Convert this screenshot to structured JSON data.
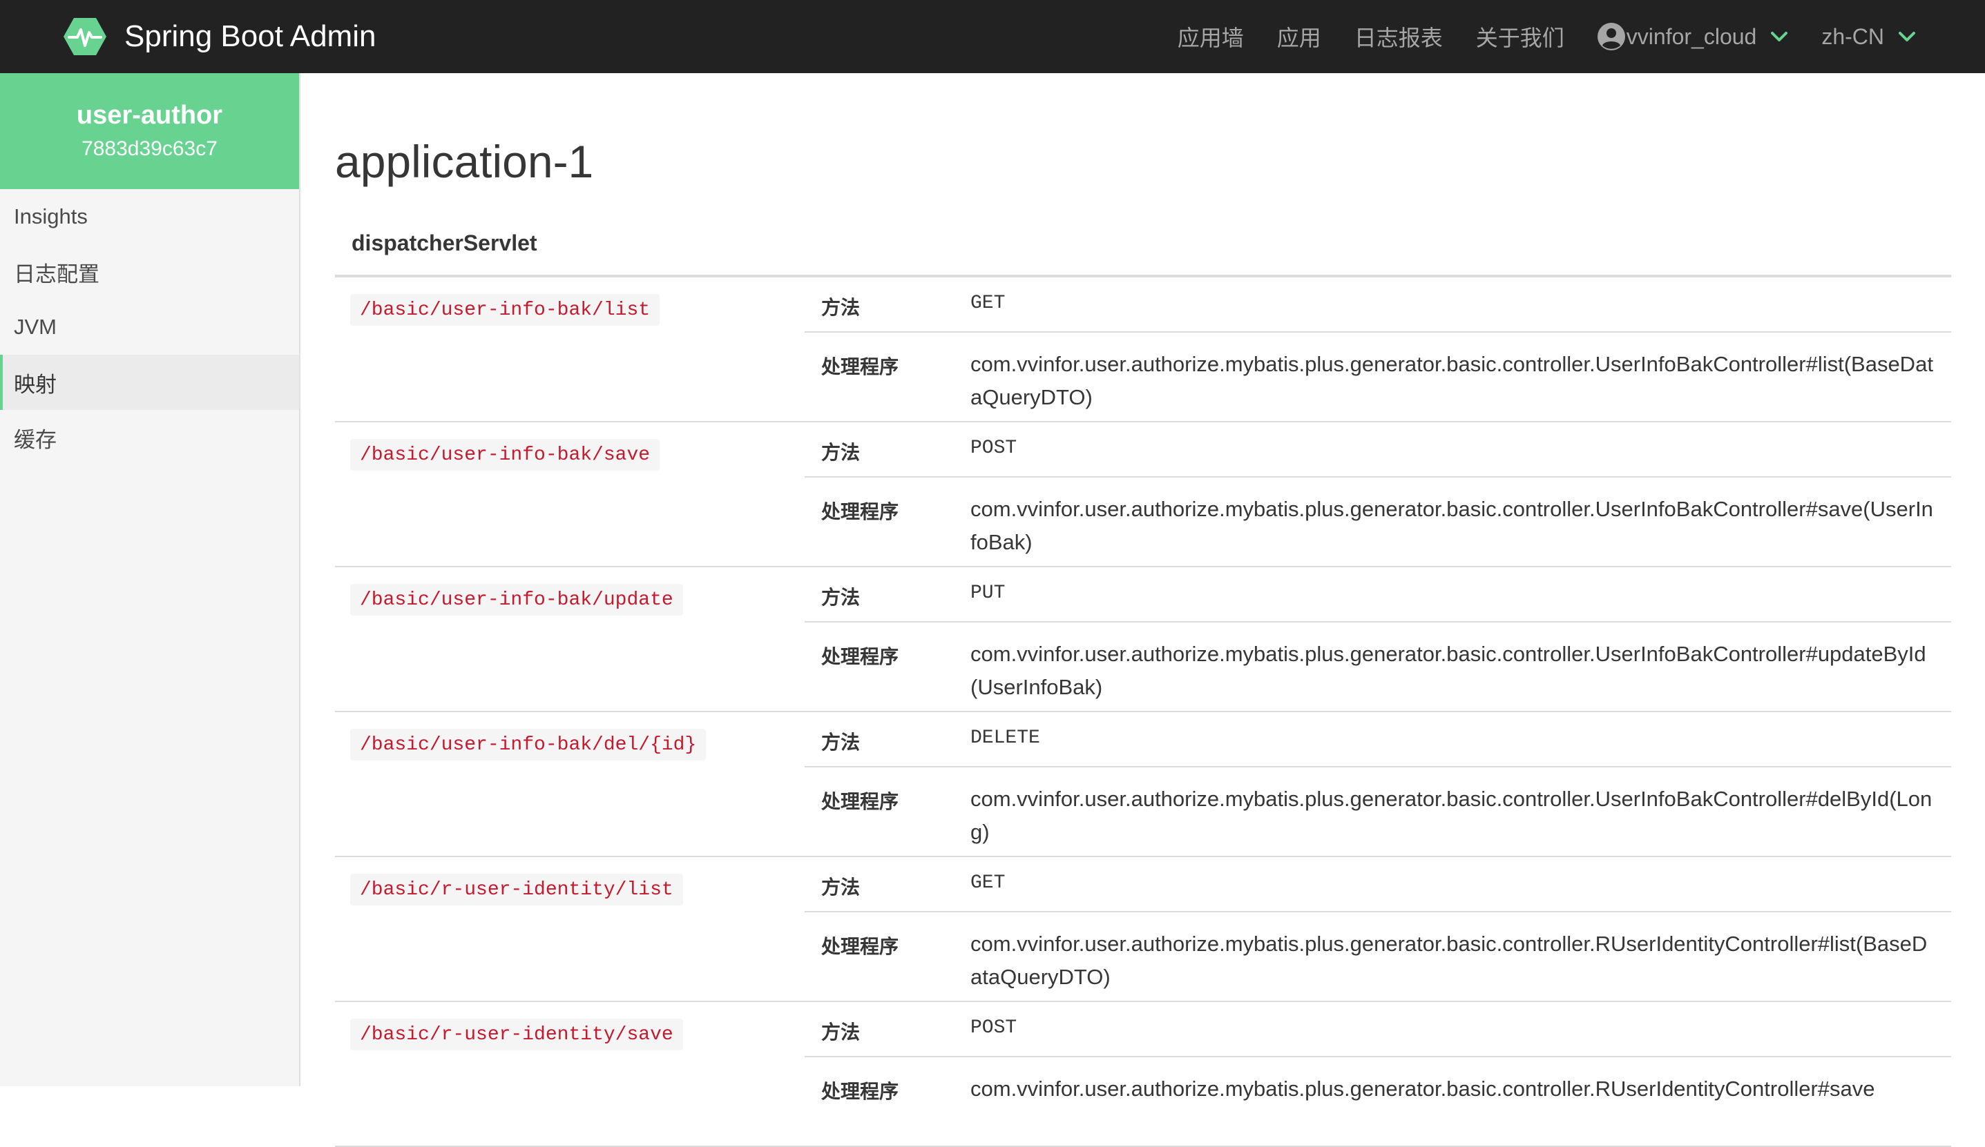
{
  "navbar": {
    "brand": "Spring Boot Admin",
    "items": [
      "应用墙",
      "应用",
      "日志报表",
      "关于我们"
    ],
    "user": "vvinfor_cloud",
    "language": "zh-CN"
  },
  "sidebar": {
    "app_name": "user-author",
    "instance_id": "7883d39c63c7",
    "items": [
      {
        "label": "Insights",
        "active": false
      },
      {
        "label": "日志配置",
        "active": false
      },
      {
        "label": "JVM",
        "active": false
      },
      {
        "label": "映射",
        "active": true
      },
      {
        "label": "缓存",
        "active": false
      }
    ]
  },
  "main": {
    "title": "application-1",
    "section": "dispatcherServlet",
    "method_label": "方法",
    "handler_label": "处理程序",
    "mappings": [
      {
        "path": "/basic/user-info-bak/list",
        "method": "GET",
        "handler": "com.vvinfor.user.authorize.mybatis.plus.generator.basic.controller.UserInfoBakController#list(BaseDataQueryDTO)"
      },
      {
        "path": "/basic/user-info-bak/save",
        "method": "POST",
        "handler": "com.vvinfor.user.authorize.mybatis.plus.generator.basic.controller.UserInfoBakController#save(UserInfoBak)"
      },
      {
        "path": "/basic/user-info-bak/update",
        "method": "PUT",
        "handler": "com.vvinfor.user.authorize.mybatis.plus.generator.basic.controller.UserInfoBakController#updateById(UserInfoBak)"
      },
      {
        "path": "/basic/user-info-bak/del/{id}",
        "method": "DELETE",
        "handler": "com.vvinfor.user.authorize.mybatis.plus.generator.basic.controller.UserInfoBakController#delById(Long)"
      },
      {
        "path": "/basic/r-user-identity/list",
        "method": "GET",
        "handler": "com.vvinfor.user.authorize.mybatis.plus.generator.basic.controller.RUserIdentityController#list(BaseDataQueryDTO)"
      },
      {
        "path": "/basic/r-user-identity/save",
        "method": "POST",
        "handler": "com.vvinfor.user.authorize.mybatis.plus.generator.basic.controller.RUserIdentityController#save"
      }
    ]
  },
  "colors": {
    "navbar_bg": "#222222",
    "accent": "#68d391",
    "path_text": "#c5192d"
  },
  "icons": {
    "brand": "heartbeat-logo-icon",
    "user": "user-circle-icon",
    "dropdown": "chevron-down-icon"
  }
}
